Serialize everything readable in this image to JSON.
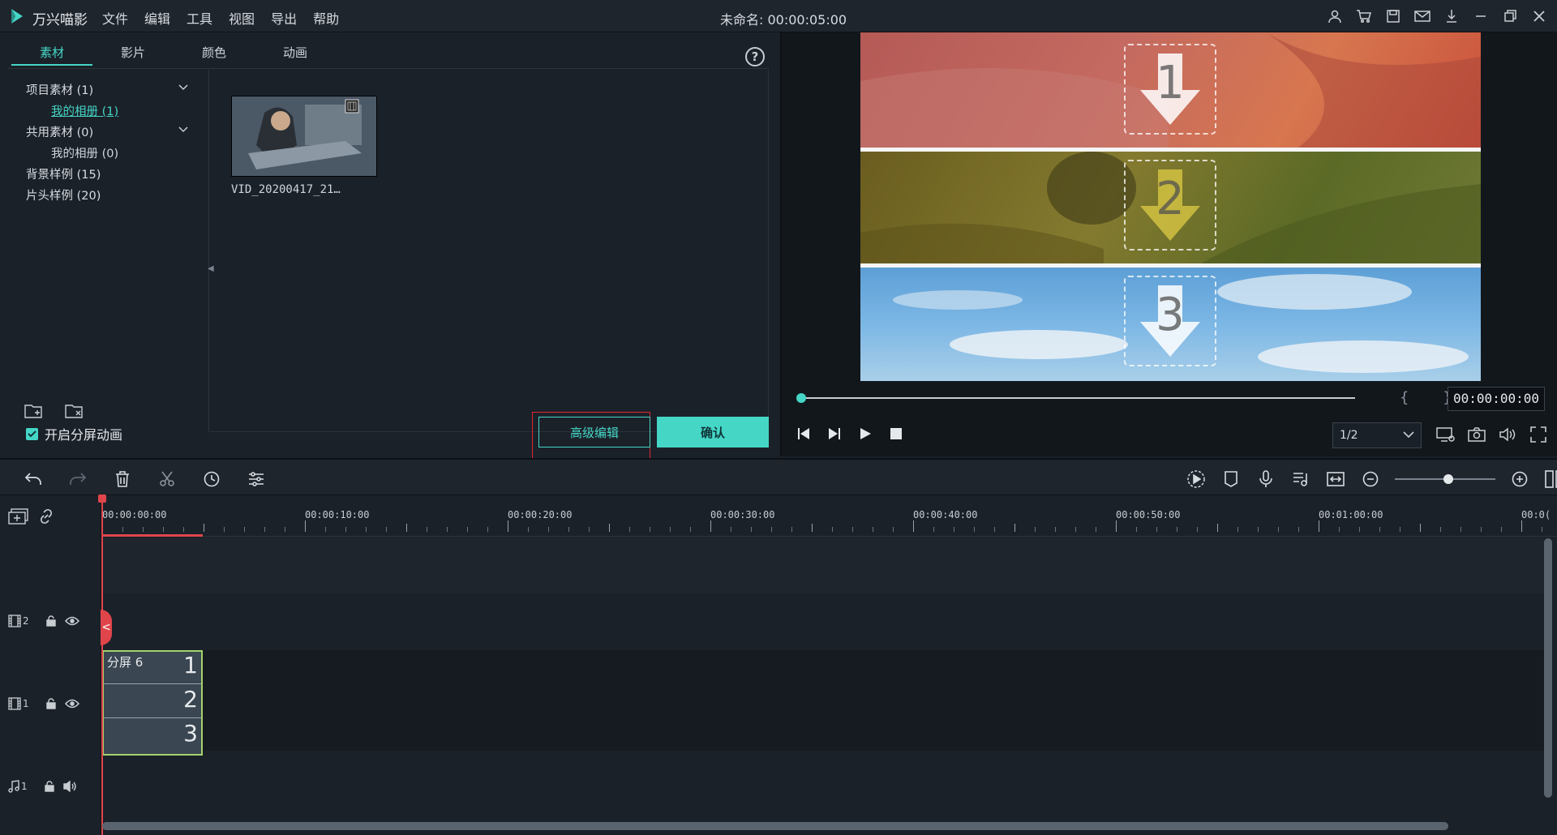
{
  "app": {
    "name": "万兴喵影",
    "menu": [
      "文件",
      "编辑",
      "工具",
      "视图",
      "导出",
      "帮助"
    ],
    "doc_title": "未命名: 00:00:05:00",
    "accent": "#45d6c6"
  },
  "media": {
    "tabs": [
      "素材",
      "影片",
      "颜色",
      "动画"
    ],
    "help_symbol": "?",
    "tree": [
      {
        "label": "项目素材 (1)"
      },
      {
        "label": "我的相册 (1)"
      },
      {
        "label": "共用素材 (0)"
      },
      {
        "label": "我的相册 (0)"
      },
      {
        "label": "背景样例 (15)"
      },
      {
        "label": "片头样例 (20)"
      }
    ],
    "clip_name": "VID_20200417_21…",
    "checkbox_label": "开启分屏动画",
    "btn_advanced": "高级编辑",
    "btn_confirm": "确认"
  },
  "preview": {
    "splits": [
      "1",
      "2",
      "3"
    ],
    "brackets": "{ }",
    "timecode": "00:00:00:00",
    "ratio": "1/2"
  },
  "timeline": {
    "ruler_labels": [
      "00:00:00:00",
      "00:00:10:00",
      "00:00:20:00",
      "00:00:30:00",
      "00:00:40:00",
      "00:00:50:00",
      "00:01:00:00",
      "00:0("
    ],
    "tracks": [
      {
        "type": "video",
        "index": "2"
      },
      {
        "type": "video",
        "index": "1"
      },
      {
        "type": "audio",
        "index": "1"
      }
    ],
    "clip": {
      "label": "分屏 6",
      "cells": [
        "1",
        "2",
        "3"
      ]
    },
    "handle_symbol": "<"
  }
}
